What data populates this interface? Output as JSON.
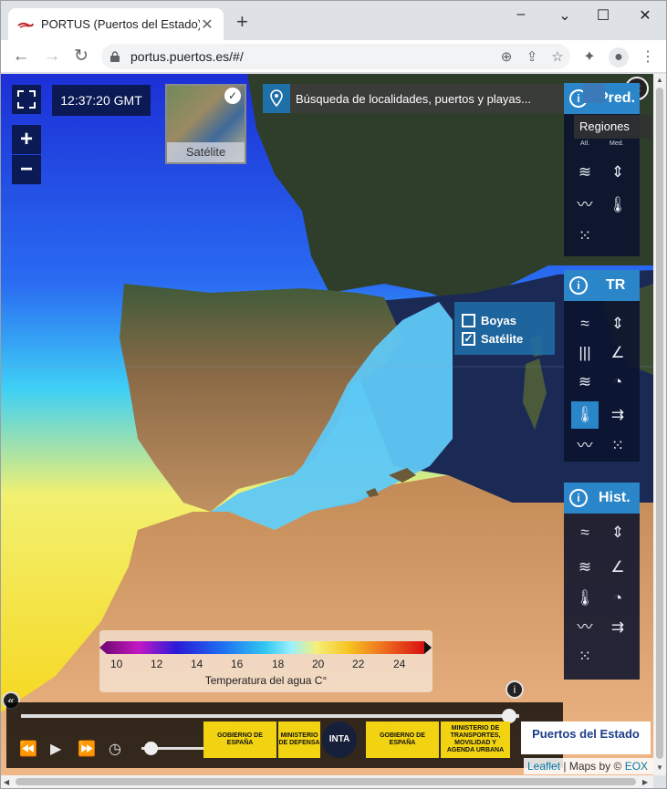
{
  "browser": {
    "tab_title": "PORTUS (Puertos del Estado)",
    "new_tab": "+",
    "url": "portus.puertos.es/#/",
    "window_controls": {
      "minimize": "–",
      "maximize": "☐",
      "close": "✕"
    },
    "nav": {
      "back": "←",
      "forward": "→",
      "reload": "↻"
    },
    "toolbar_icons": [
      "zoom-icon",
      "share-icon",
      "bookmark-star-icon",
      "extensions-icon",
      "profile-icon",
      "menu-icon"
    ]
  },
  "map": {
    "time": "12:37:20 GMT",
    "zoom_in": "+",
    "zoom_out": "−",
    "basemap_label": "Satélite",
    "search_placeholder": "Búsqueda de localidades, puertos y playas...",
    "collapse_label": "«",
    "layer_toggle": {
      "items": [
        {
          "label": "Boyas",
          "checked": false
        },
        {
          "label": "Satélite",
          "checked": true
        }
      ]
    },
    "pred_panel": {
      "title": "Pred.",
      "regions_tooltip": "Regiones",
      "sublabels": [
        "Atl.",
        "Med."
      ]
    },
    "tr_panel": {
      "title": "TR"
    },
    "hist_panel": {
      "title": "Hist."
    },
    "legend": {
      "ticks": [
        "10",
        "12",
        "14",
        "16",
        "18",
        "20",
        "22",
        "24"
      ],
      "label": "Temperatura del agua C°"
    },
    "timeline": {
      "position_fraction": 0.98,
      "speed_fraction": 0.15
    },
    "attribution": {
      "leaflet": "Leaflet",
      "sep": " | ",
      "maps_by": "Maps by © ",
      "eox": "EOX"
    },
    "logos": [
      "GOBIERNO DE ESPAÑA",
      "MINISTERIO DE DEFENSA",
      "INTA",
      "GOBIERNO DE ESPAÑA",
      "MINISTERIO DE TRANSPORTES, MOVILIDAD Y AGENDA URBANA"
    ],
    "brand": "Puertos del Estado"
  }
}
